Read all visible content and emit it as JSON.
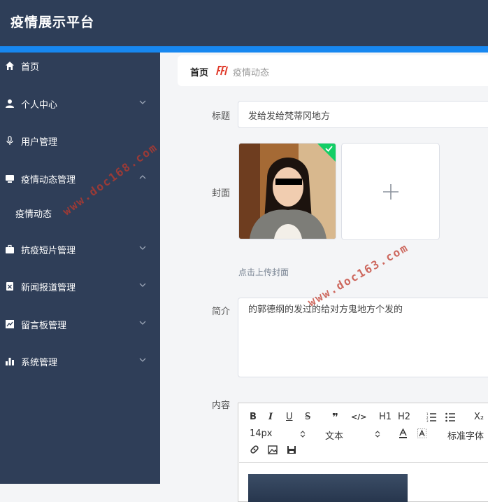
{
  "app": {
    "title": "疫情展示平台"
  },
  "sidebar": {
    "items": [
      {
        "label": "首页",
        "icon": "home-icon"
      },
      {
        "label": "个人中心",
        "icon": "user-icon"
      },
      {
        "label": "用户管理",
        "icon": "microphone-icon"
      },
      {
        "label": "疫情动态管理",
        "icon": "monitor-icon"
      },
      {
        "label": "疫情动态"
      },
      {
        "label": "抗疫短片管理",
        "icon": "briefcase-icon"
      },
      {
        "label": "新闻报道管理",
        "icon": "document-x-icon"
      },
      {
        "label": "留言板管理",
        "icon": "line-chart-icon"
      },
      {
        "label": "系统管理",
        "icon": "bar-chart-icon"
      }
    ]
  },
  "breadcrumb": {
    "home": "首页",
    "current": "疫情动态"
  },
  "form": {
    "title_label": "标题",
    "title_value": "发给发给梵蒂冈地方",
    "cover_label": "封面",
    "cover_hint": "点击上传封面",
    "intro_label": "简介",
    "intro_value": "的郭德纲的发过的给对方鬼地方个发的",
    "content_label": "内容"
  },
  "editor": {
    "buttons": [
      "B",
      "I",
      "U",
      "S",
      "❞",
      "</>",
      "H1",
      "H2",
      "ordered-list",
      "bullet-list",
      "X₂"
    ],
    "font_size": "14px",
    "paragraph": "文本",
    "font_family": "标准字体"
  },
  "watermarks": [
    "www.doc168.com",
    "www.doc163.com"
  ],
  "colors": {
    "header": "#2e3e58",
    "accent": "#1787f0",
    "sidebar": "#2f3e58"
  }
}
